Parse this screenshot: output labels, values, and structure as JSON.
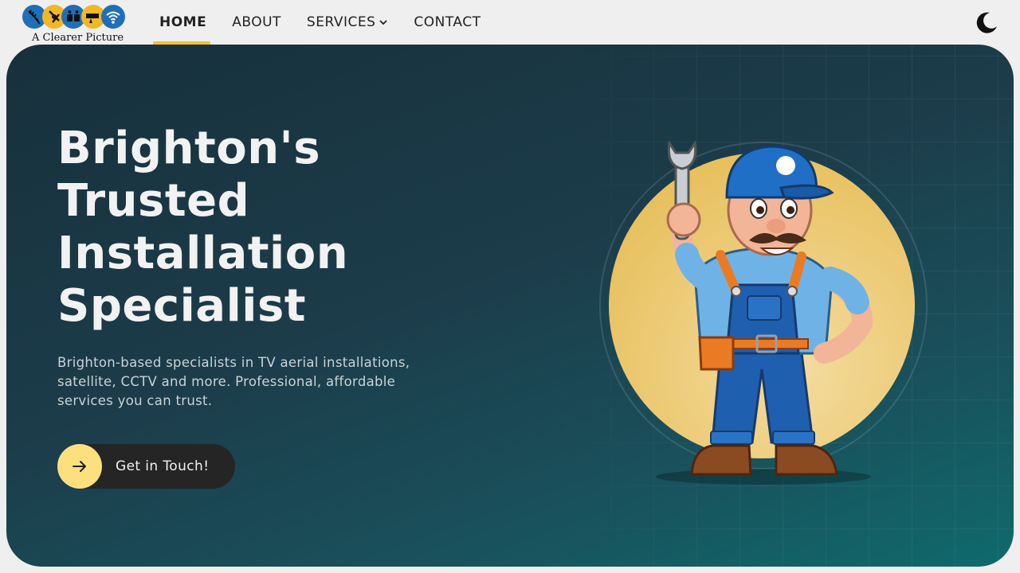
{
  "brand": {
    "name": "A Clearer Picture",
    "circle_colors": [
      "#1f6fb8",
      "#f2b824",
      "#1f6fb8",
      "#f2b824",
      "#1f6fb8"
    ]
  },
  "nav": {
    "items": [
      {
        "label": "HOME",
        "active": true
      },
      {
        "label": "ABOUT",
        "active": false
      },
      {
        "label": "SERVICES",
        "active": false,
        "has_dropdown": true
      },
      {
        "label": "CONTACT",
        "active": false
      }
    ],
    "theme_toggle_icon": "moon-icon"
  },
  "hero": {
    "headline_lines": [
      "Brighton's",
      "Trusted",
      "Installation",
      "Specialist"
    ],
    "subtext": "Brighton-based specialists in TV aerial installations, satellite, CCTV and more. Professional, affordable services you can trust.",
    "cta": {
      "label": "Get in Touch!",
      "icon": "arrow-right-icon"
    },
    "illustration": "handyman-mascot-with-wrench"
  },
  "colors": {
    "accent": "#f1c232",
    "cta_icon_bg": "#fde07e",
    "hero_gradient_start": "#17303c",
    "hero_gradient_end": "#0f6a6c",
    "mascot_circle": "#ebc766"
  }
}
